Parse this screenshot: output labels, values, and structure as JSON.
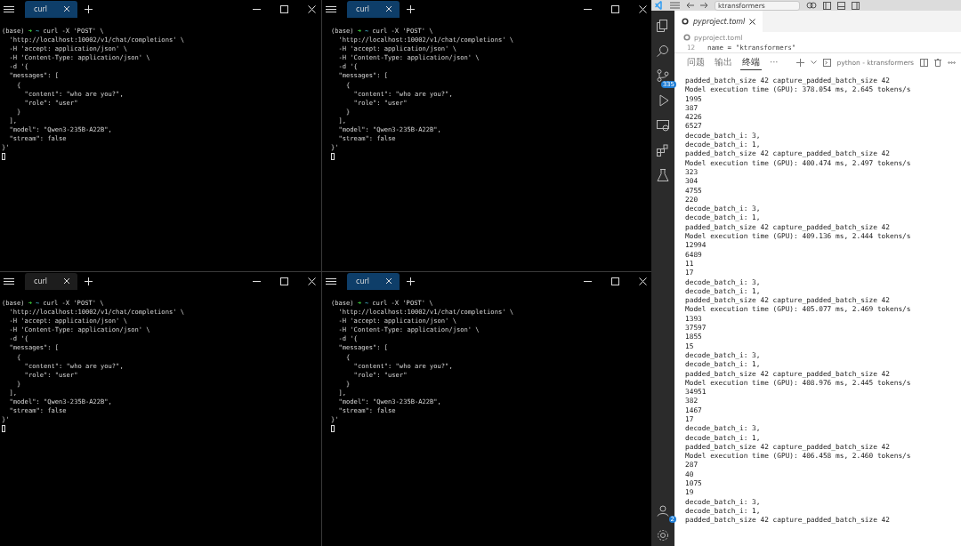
{
  "terminals": [
    {
      "tab": {
        "label": "curl",
        "selected": true
      },
      "prompt": {
        "env": "(base)",
        "arrow": "➜",
        "dir": "~",
        "command": "curl -X 'POST' \\"
      },
      "lines": [
        "  'http://localhost:10002/v1/chat/completions' \\",
        "  -H 'accept: application/json' \\",
        "  -H 'Content-Type: application/json' \\",
        "  -d '{",
        "  \"messages\": [",
        "    {",
        "      \"content\": \"who are you?\",",
        "      \"role\": \"user\"",
        "    }",
        "  ],",
        "  \"model\": \"Qwen3-235B-A22B\",",
        "  \"stream\": false",
        "}'"
      ]
    },
    {
      "tab": {
        "label": "curl",
        "selected": true
      },
      "prompt": {
        "env": "(base)",
        "arrow": "➜",
        "dir": "~",
        "command": "curl -X 'POST' \\"
      },
      "lines": [
        "  'http://localhost:10002/v1/chat/completions' \\",
        "  -H 'accept: application/json' \\",
        "  -H 'Content-Type: application/json' \\",
        "  -d '{",
        "  \"messages\": [",
        "    {",
        "      \"content\": \"who are you?\",",
        "      \"role\": \"user\"",
        "    }",
        "  ],",
        "  \"model\": \"Qwen3-235B-A22B\",",
        "  \"stream\": false",
        "}'"
      ]
    },
    {
      "tab": {
        "label": "curl",
        "selected": false
      },
      "prompt": {
        "env": "(base)",
        "arrow": "➜",
        "dir": "~",
        "command": "curl -X 'POST' \\"
      },
      "lines": [
        "  'http://localhost:10002/v1/chat/completions' \\",
        "  -H 'accept: application/json' \\",
        "  -H 'Content-Type: application/json' \\",
        "  -d '{",
        "  \"messages\": [",
        "    {",
        "      \"content\": \"who are you?\",",
        "      \"role\": \"user\"",
        "    }",
        "  ],",
        "  \"model\": \"Qwen3-235B-A22B\",",
        "  \"stream\": false",
        "}'"
      ]
    },
    {
      "tab": {
        "label": "curl",
        "selected": true
      },
      "prompt": {
        "env": "(base)",
        "arrow": "➜",
        "dir": "~",
        "command": "curl -X 'POST' \\"
      },
      "lines": [
        "  'http://localhost:10002/v1/chat/completions' \\",
        "  -H 'accept: application/json' \\",
        "  -H 'Content-Type: application/json' \\",
        "  -d '{",
        "  \"messages\": [",
        "    {",
        "      \"content\": \"who are you?\",",
        "      \"role\": \"user\"",
        "    }",
        "  ],",
        "  \"model\": \"Qwen3-235B-A22B\",",
        "  \"stream\": false",
        "}'"
      ]
    }
  ],
  "vscode": {
    "search": {
      "value": "ktransformers"
    },
    "activity_badges": {
      "source_control": "335",
      "accounts": "2"
    },
    "editor_tab": {
      "label": "pyproject.toml",
      "selected": true
    },
    "breadcrumb": "pyproject.toml",
    "code_line": {
      "number": "12",
      "text": "name = \"ktransformers\""
    },
    "panel_tabs": [
      {
        "label": "问题",
        "selected": false
      },
      {
        "label": "输出",
        "selected": false
      },
      {
        "label": "终端",
        "selected": true
      },
      {
        "label": "···",
        "selected": false
      }
    ],
    "terminal_name": "python - ktransformers",
    "output": [
      "padded_batch_size 42 capture_padded_batch_size 42",
      "Model execution time (GPU): 378.054 ms, 2.645 tokens/s",
      "1995",
      "387",
      "4226",
      "6527",
      "decode_batch_i: 3,",
      "decode_batch_i: 1,",
      "padded_batch_size 42 capture_padded_batch_size 42",
      "Model execution time (GPU): 400.474 ms, 2.497 tokens/s",
      "323",
      "304",
      "4755",
      "220",
      "decode_batch_i: 3,",
      "decode_batch_i: 1,",
      "padded_batch_size 42 capture_padded_batch_size 42",
      "Model execution time (GPU): 409.136 ms, 2.444 tokens/s",
      "12994",
      "6489",
      "11",
      "17",
      "decode_batch_i: 3,",
      "decode_batch_i: 1,",
      "padded_batch_size 42 capture_padded_batch_size 42",
      "Model execution time (GPU): 405.077 ms, 2.469 tokens/s",
      "1393",
      "37597",
      "1855",
      "15",
      "decode_batch_i: 3,",
      "decode_batch_i: 1,",
      "padded_batch_size 42 capture_padded_batch_size 42",
      "Model execution time (GPU): 408.976 ms, 2.445 tokens/s",
      "34951",
      "382",
      "1467",
      "17",
      "decode_batch_i: 3,",
      "decode_batch_i: 1,",
      "padded_batch_size 42 capture_padded_batch_size 42",
      "Model execution time (GPU): 406.458 ms, 2.460 tokens/s",
      "287",
      "40",
      "1075",
      "19",
      "decode_batch_i: 3,",
      "decode_batch_i: 1,",
      "padded_batch_size 42 capture_padded_batch_size 42"
    ]
  }
}
